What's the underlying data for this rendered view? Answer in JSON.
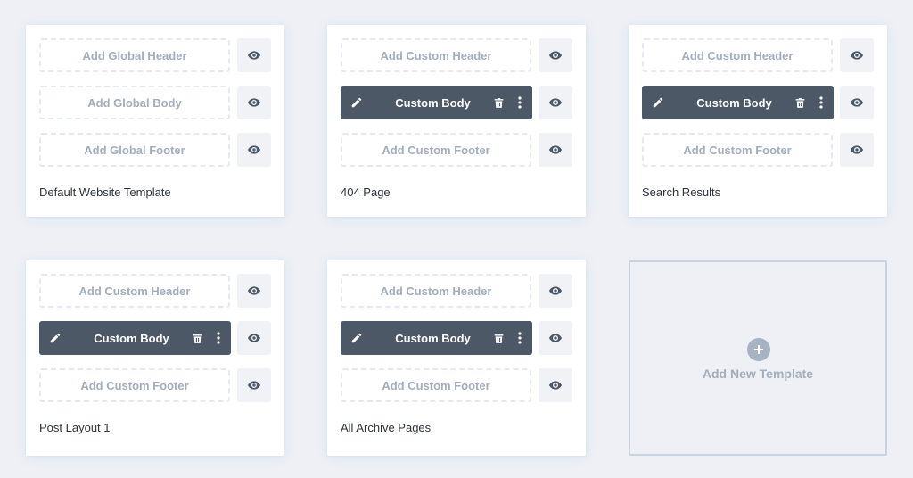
{
  "cards": [
    {
      "title": "Default Website Template",
      "header": {
        "type": "empty",
        "label": "Add Global Header"
      },
      "body": {
        "type": "empty",
        "label": "Add Global Body"
      },
      "footer": {
        "type": "empty",
        "label": "Add Global Footer"
      }
    },
    {
      "title": "404 Page",
      "header": {
        "type": "empty",
        "label": "Add Custom Header"
      },
      "body": {
        "type": "filled",
        "label": "Custom Body"
      },
      "footer": {
        "type": "empty",
        "label": "Add Custom Footer"
      }
    },
    {
      "title": "Search Results",
      "header": {
        "type": "empty",
        "label": "Add Custom Header"
      },
      "body": {
        "type": "filled",
        "label": "Custom Body"
      },
      "footer": {
        "type": "empty",
        "label": "Add Custom Footer"
      }
    },
    {
      "title": "Post Layout 1",
      "header": {
        "type": "empty",
        "label": "Add Custom Header"
      },
      "body": {
        "type": "filled",
        "label": "Custom Body"
      },
      "footer": {
        "type": "empty",
        "label": "Add Custom Footer"
      }
    },
    {
      "title": "All Archive Pages",
      "header": {
        "type": "empty",
        "label": "Add Custom Header"
      },
      "body": {
        "type": "filled",
        "label": "Custom Body"
      },
      "footer": {
        "type": "empty",
        "label": "Add Custom Footer"
      }
    }
  ],
  "add_template": {
    "label": "Add New Template"
  },
  "icons": {
    "visibility": "eye-icon",
    "edit": "pencil-icon",
    "delete": "trash-icon",
    "more": "more-vertical-icon",
    "add": "plus-icon"
  },
  "colors": {
    "background": "#eef0f5",
    "card": "#ffffff",
    "layout_bar": "#4c5866",
    "muted_text": "#a3adbb",
    "eye_icon": "#4c5866"
  }
}
